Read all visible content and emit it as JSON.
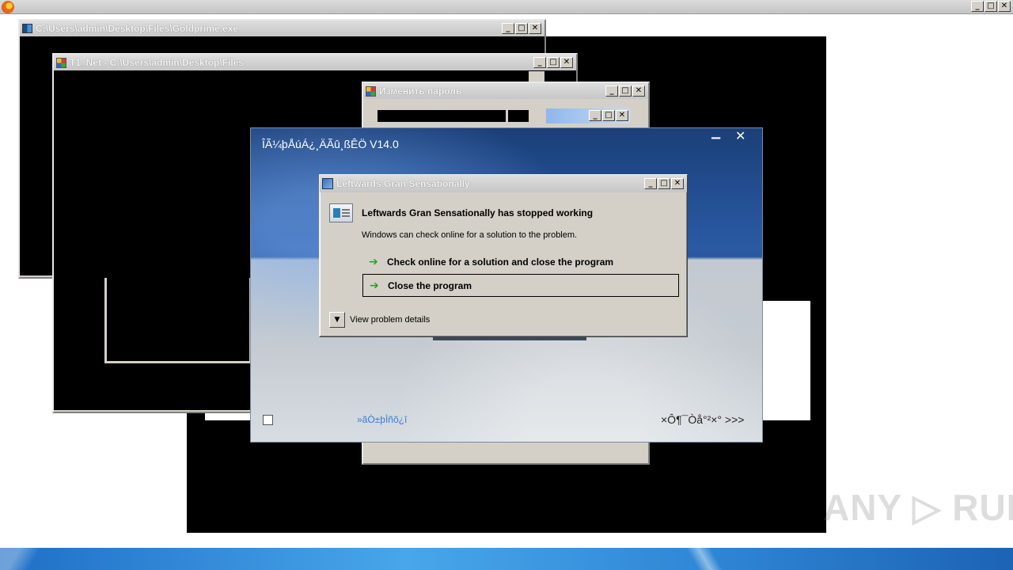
{
  "topbar": {
    "min": "_",
    "max": "□",
    "close": "✕"
  },
  "windows": {
    "goldprime": {
      "title": "C:\\Users\\admin\\Desktop\\Files\\Goldprime.exe"
    },
    "t1net": {
      "title": "T1_Net - C:\\Users\\admin\\Desktop\\Files"
    },
    "password": {
      "title": "Изменить пароль"
    }
  },
  "installer": {
    "title": "ÎÃ¼þÅúÁ¿¸ÄÃû¸ßÊÖ V14.0",
    "minimize": "−",
    "close": "✕",
    "link": "»ãÒ±þÌñõ¿î",
    "next": "×Ô¶¯Òå°²×° >>>"
  },
  "dialog": {
    "title": "Leftwards Gran Sensationally",
    "heading": "Leftwards Gran Sensationally has stopped working",
    "subtext": "Windows can check online for a solution to the problem.",
    "options": [
      {
        "label": "Check online for a solution and close the program"
      },
      {
        "label": "Close the program"
      }
    ],
    "details": "View problem details",
    "buttons": {
      "min": "_",
      "max": "□",
      "close": "✕"
    }
  },
  "watermark": "ANY ▷ RUN",
  "icons": [
    "firefox-icon",
    "console-app-icon",
    "app-window-icon",
    "error-report-icon",
    "green-arrow-icon",
    "chevron-down-icon"
  ]
}
